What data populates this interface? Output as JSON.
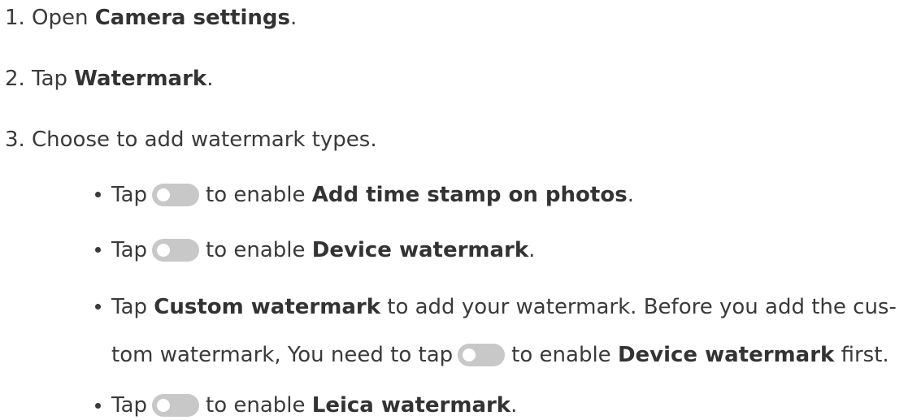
{
  "steps": [
    {
      "num": "1.",
      "pre": "Open ",
      "bold": "Camera settings",
      "post": "."
    },
    {
      "num": "2.",
      "pre": "Tap ",
      "bold": "Watermark",
      "post": "."
    },
    {
      "num": "3.",
      "text": "Choose to add watermark types."
    }
  ],
  "bullets": [
    {
      "pre": "Tap",
      "mid": "to enable ",
      "bold": "Add time stamp on photos",
      "post": "."
    },
    {
      "pre": "Tap",
      "mid": "to enable ",
      "bold": "Device watermark",
      "post": "."
    },
    {
      "pre": "Tap ",
      "bold": "Custom watermark",
      "post": " to add your watermark. Before you add the cus-",
      "line2_pre": "tom watermark, You need to tap",
      "line2_mid": "to enable ",
      "line2_bold": "Device watermark",
      "line2_post": " first."
    },
    {
      "pre": "Tap",
      "mid": "to enable ",
      "bold": "Leica watermark",
      "post": "."
    }
  ]
}
